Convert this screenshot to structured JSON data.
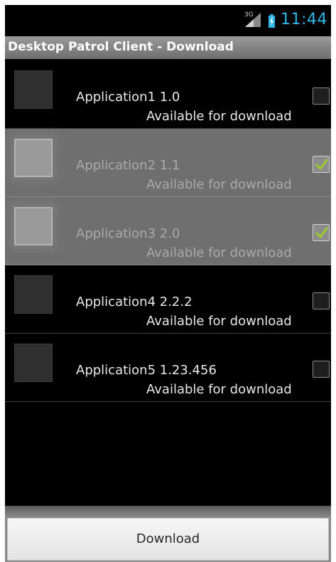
{
  "status_bar": {
    "signal_label": "3G",
    "time": "11:44",
    "accent_color": "#33b5e5",
    "icons": [
      "signal-icon",
      "battery-icon"
    ]
  },
  "title": "Desktop Patrol Client - Download",
  "apps": [
    {
      "name": "Application1 1.0",
      "status": "Available for download",
      "checked": false
    },
    {
      "name": "Application2 1.1",
      "status": "Available for download",
      "checked": true
    },
    {
      "name": "Application3 2.0",
      "status": "Available for download",
      "checked": true
    },
    {
      "name": "Application4 2.2.2",
      "status": "Available for download",
      "checked": false
    },
    {
      "name": "Application5 1.23.456",
      "status": "Available for download",
      "checked": false
    }
  ],
  "colors": {
    "check_mark": "#9ccc2c",
    "selected_row": "#6f6f6f"
  },
  "download_button": {
    "label": "Download"
  }
}
